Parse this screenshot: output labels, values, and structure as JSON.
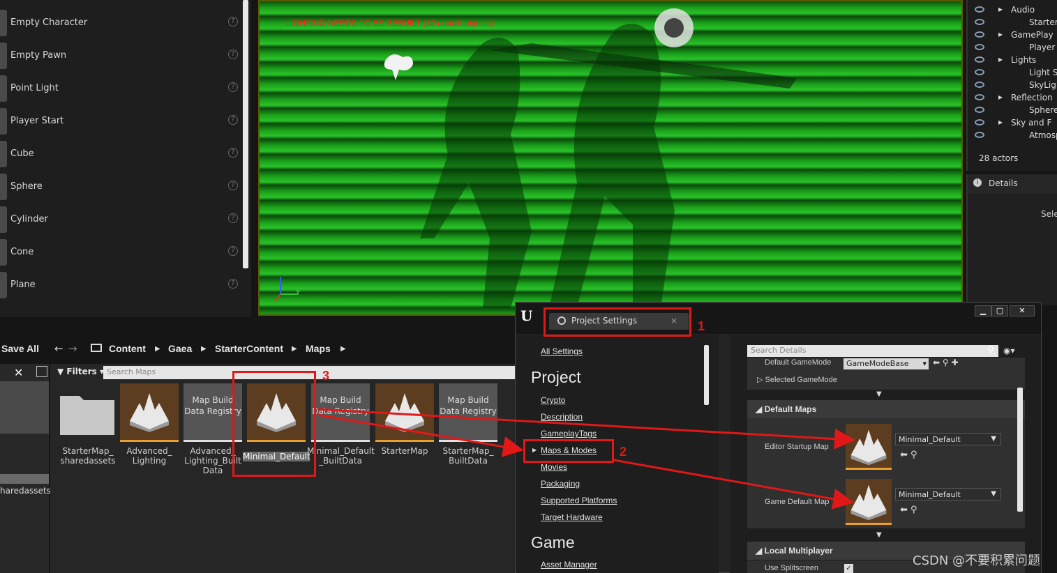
{
  "place_actors": {
    "items": [
      {
        "label": "Empty Character"
      },
      {
        "label": "Empty Pawn"
      },
      {
        "label": "Point Light"
      },
      {
        "label": "Player Start"
      },
      {
        "label": "Cube"
      },
      {
        "label": "Sphere"
      },
      {
        "label": "Cylinder"
      },
      {
        "label": "Cone"
      },
      {
        "label": "Plane"
      }
    ],
    "help_glyph": "?"
  },
  "viewport": {
    "warning": "LIGHTING NEEDS TO BE REBUILT (10 unbuilt objects)",
    "axis_y": "Y"
  },
  "outliner": {
    "rows": [
      {
        "label": "Audio"
      },
      {
        "label": "Starter_"
      },
      {
        "label": "GamePlay"
      },
      {
        "label": "Player S"
      },
      {
        "label": "Lights"
      },
      {
        "label": "Light So"
      },
      {
        "label": "SkyLigh"
      },
      {
        "label": "Reflection"
      },
      {
        "label": "SphereR"
      },
      {
        "label": "Sky and F"
      },
      {
        "label": "Atmosp"
      }
    ],
    "count": "28 actors",
    "details_tab": "Details",
    "details_partial": "Sele"
  },
  "content_browser": {
    "save_all": "Save All",
    "breadcrumbs": [
      "Content",
      "Gaea",
      "StarterContent",
      "Maps"
    ],
    "filters_label": "Filters",
    "search_placeholder": "Search Maps",
    "left_partial": "haredassets",
    "assets": [
      {
        "name": "StarterMap_ sharedassets",
        "tile_text": ""
      },
      {
        "name": "Advanced_ Lighting",
        "tile_text": ""
      },
      {
        "name": "Advanced_ Lighting_Built Data",
        "tile_text": "Map Build Data Registry"
      },
      {
        "name": "Minimal_Default",
        "tile_text": ""
      },
      {
        "name": "Minimal_Default _BuiltData",
        "tile_text": "Map Build Data Registry"
      },
      {
        "name": "StarterMap",
        "tile_text": ""
      },
      {
        "name": "StarterMap_ BuiltData",
        "tile_text": "Map Build Data Registry"
      }
    ]
  },
  "project_settings": {
    "tab_title": "Project Settings",
    "tab_close": "×",
    "window_buttons": [
      "▁",
      "▢",
      "✕"
    ],
    "nav": {
      "all_settings": "All Settings",
      "project_heading": "Project",
      "project_items": [
        "Crypto",
        "Description",
        "GameplayTags",
        "Maps & Modes",
        "Movies",
        "Packaging",
        "Supported Platforms",
        "Target Hardware"
      ],
      "game_heading": "Game",
      "game_items": [
        "Asset Manager"
      ]
    },
    "details": {
      "search_placeholder": "Search Details",
      "default_gamemode_label": "Default GameMode",
      "default_gamemode_value": "GameModeBase",
      "selected_gamemode": "Selected GameMode",
      "default_maps_heading": "Default Maps",
      "editor_startup_label": "Editor Startup Map",
      "editor_startup_value": "Minimal_Default",
      "game_default_label": "Game Default Map",
      "game_default_value": "Minimal_Default",
      "local_multiplayer_heading": "Local Multiplayer",
      "use_splitscreen": "Use Splitscreen"
    }
  },
  "annotations": {
    "numbers": [
      "1",
      "2",
      "3"
    ],
    "color": "#e01818"
  },
  "watermark": "CSDN @不要积累问题"
}
